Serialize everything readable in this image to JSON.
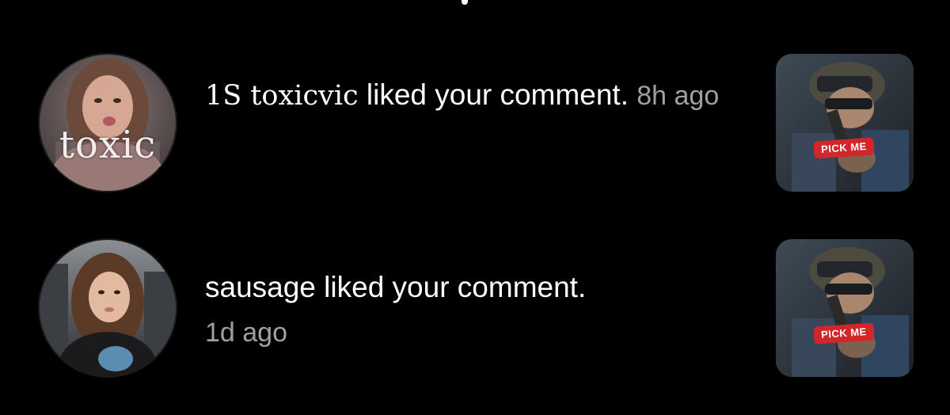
{
  "notifications": [
    {
      "avatar_caption": "toxic",
      "username": "1S toxicvic",
      "action": " liked your comment.",
      "time": "8h ago",
      "thumbnail_badge": "PICK ME"
    },
    {
      "avatar_caption": "",
      "username": "sausage",
      "action": " liked your comment.",
      "time": "1d ago",
      "thumbnail_badge": "PICK ME"
    }
  ],
  "colors": {
    "background": "#000000",
    "primary_text": "#ffffff",
    "secondary_text": "#a0a0a0",
    "badge": "#d3262b"
  }
}
